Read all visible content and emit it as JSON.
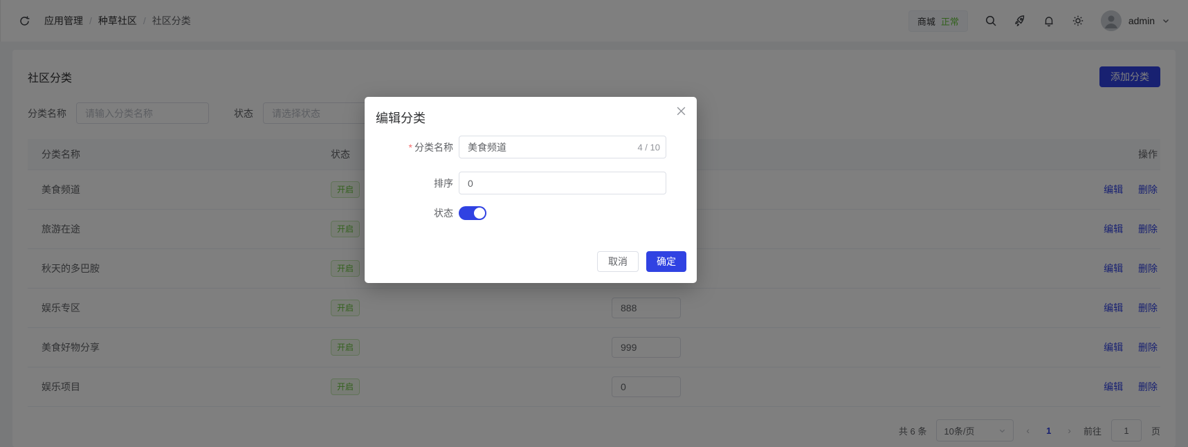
{
  "colors": {
    "primary": "#3042e2",
    "success_text": "#67c23a",
    "success_bg": "#f0f9eb",
    "success_border": "#c2e7b0"
  },
  "header": {
    "breadcrumb": [
      "应用管理",
      "种草社区",
      "社区分类"
    ],
    "separator": "/",
    "shop_badge": {
      "name": "商城",
      "status": "正常"
    },
    "icon_names": [
      "refresh-icon",
      "search-icon",
      "rocket-icon",
      "bell-icon",
      "gear-icon",
      "avatar",
      "chevron-down-icon"
    ],
    "user": {
      "name": "admin"
    }
  },
  "toolbar": {
    "title": "社区分类",
    "add_button": "添加分类"
  },
  "filters": {
    "name_label": "分类名称",
    "name_placeholder": "请输入分类名称",
    "status_label": "状态",
    "status_placeholder": "请选择状态"
  },
  "table": {
    "headers": {
      "name": "分类名称",
      "status": "状态",
      "action": "操作"
    },
    "actions": {
      "edit": "编辑",
      "delete": "删除"
    },
    "rows": [
      {
        "name": "美食频道",
        "status": "开启",
        "sort": ""
      },
      {
        "name": "旅游在途",
        "status": "开启",
        "sort": ""
      },
      {
        "name": "秋天的多巴胺",
        "status": "开启",
        "sort": ""
      },
      {
        "name": "娱乐专区",
        "status": "开启",
        "sort": "888"
      },
      {
        "name": "美食好物分享",
        "status": "开启",
        "sort": "999"
      },
      {
        "name": "娱乐项目",
        "status": "开启",
        "sort": "0"
      }
    ]
  },
  "pagination": {
    "total": "共 6 条",
    "page_size": "10条/页",
    "current": "1",
    "goto_label": "前往",
    "goto_value": "1",
    "unit": "页"
  },
  "modal": {
    "title": "编辑分类",
    "name_label": "分类名称",
    "name_value": "美食频道",
    "name_counter": "4 / 10",
    "sort_label": "排序",
    "sort_value": "0",
    "status_label": "状态",
    "status_on": true,
    "cancel": "取消",
    "confirm": "确定"
  }
}
